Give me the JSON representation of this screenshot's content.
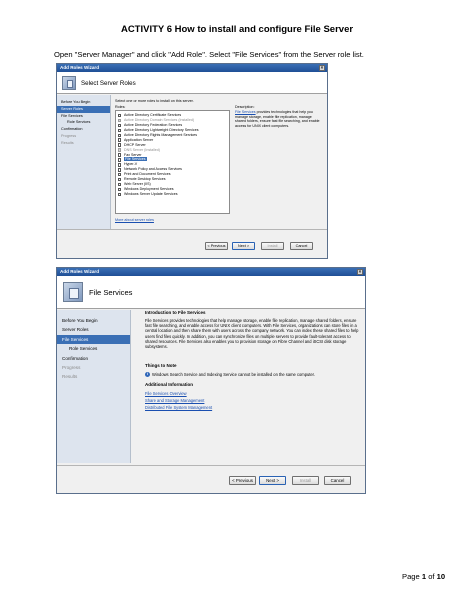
{
  "document": {
    "title": "ACTIVITY 6 How to install and configure File Server",
    "instruction": "Open \"Server Manager\" and click \"Add Role\". Select \"File Services\" from the Server role list.",
    "page": {
      "prefix": "Page ",
      "current": "1",
      "of": " of ",
      "total": "10"
    }
  },
  "wizard1": {
    "window_title": "Add Roles Wizard",
    "close_glyph": "×",
    "header_title": "Select Server Roles",
    "nav": [
      {
        "label": "Before You Begin",
        "state": "normal"
      },
      {
        "label": "Server Roles",
        "state": "active"
      },
      {
        "label": "File Services",
        "state": "normal"
      },
      {
        "label": "Role Services",
        "state": "sub"
      },
      {
        "label": "Confirmation",
        "state": "normal"
      },
      {
        "label": "Progress",
        "state": "grey"
      },
      {
        "label": "Results",
        "state": "grey"
      }
    ],
    "instruction": "Select one or more roles to install on this server.",
    "roles_label": "Roles:",
    "description_label": "Description:",
    "roles": [
      {
        "label": "Active Directory Certificate Services",
        "state": "normal"
      },
      {
        "label": "Active Directory Domain Services  (Installed)",
        "state": "grey"
      },
      {
        "label": "Active Directory Federation Services",
        "state": "normal"
      },
      {
        "label": "Active Directory Lightweight Directory Services",
        "state": "normal"
      },
      {
        "label": "Active Directory Rights Management Services",
        "state": "normal"
      },
      {
        "label": "Application Server",
        "state": "normal"
      },
      {
        "label": "DHCP Server",
        "state": "normal"
      },
      {
        "label": "DNS Server  (Installed)",
        "state": "grey"
      },
      {
        "label": "Fax Server",
        "state": "normal"
      },
      {
        "label": "File Services",
        "state": "selected"
      },
      {
        "label": "Hyper-V",
        "state": "normal"
      },
      {
        "label": "Network Policy and Access Services",
        "state": "normal"
      },
      {
        "label": "Print and Document Services",
        "state": "normal"
      },
      {
        "label": "Remote Desktop Services",
        "state": "normal"
      },
      {
        "label": "Web Server (IIS)",
        "state": "normal"
      },
      {
        "label": "Windows Deployment Services",
        "state": "normal"
      },
      {
        "label": "Windows Server Update Services",
        "state": "normal"
      }
    ],
    "description_link": "File Services",
    "description_text": " provides technologies that help you manage storage, enable file replication, manage shared folders, ensure fast file searching, and enable access for UNIX client computers.",
    "more_link": "More about server roles",
    "buttons": {
      "previous": "< Previous",
      "next": "Next >",
      "install": "Install",
      "cancel": "Cancel"
    }
  },
  "wizard2": {
    "window_title": "Add Roles Wizard",
    "close_glyph": "×",
    "header_title": "File Services",
    "nav": [
      {
        "label": "Before You Begin",
        "state": "normal"
      },
      {
        "label": "Server Roles",
        "state": "normal"
      },
      {
        "label": "File Services",
        "state": "active"
      },
      {
        "label": "Role Services",
        "state": "sub"
      },
      {
        "label": "Confirmation",
        "state": "normal"
      },
      {
        "label": "Progress",
        "state": "grey"
      },
      {
        "label": "Results",
        "state": "grey"
      }
    ],
    "intro_heading": "Introduction to File Services",
    "intro_text": "File Services provides technologies that help manage storage, enable file replication, manage shared folders, ensure fast file searching, and enable access for UNIX client computers. With File Services, organizations can store files in a central location and then share them with users across the company network. You can index these shared files to help users find files quickly. In addition, you can synchronize files on multiple servers to provide fault-tolerant access to shared resources. File Services also enables you to provision storage on Fibre Channel and iSCSI disk storage subsystems.",
    "notes_heading": "Things to Note",
    "note_glyph": "i",
    "note_text": "Windows Search Service and Indexing Service cannot be installed on the same computer.",
    "info_heading": "Additional Information",
    "links": [
      "File Services Overview",
      "Share and Storage Management",
      "Distributed File System Management"
    ],
    "buttons": {
      "previous": "< Previous",
      "next": "Next >",
      "install": "Install",
      "cancel": "Cancel"
    }
  }
}
